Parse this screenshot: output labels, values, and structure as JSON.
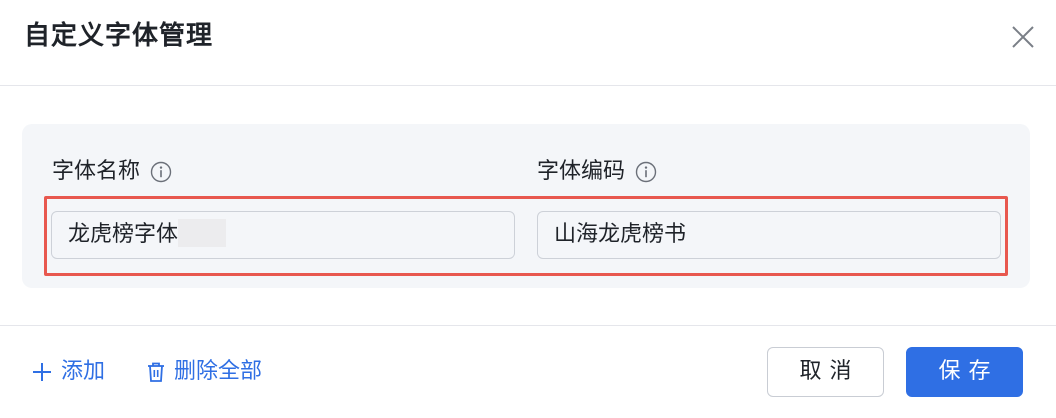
{
  "dialog": {
    "title": "自定义字体管理"
  },
  "form": {
    "font_name_label": "字体名称",
    "font_code_label": "字体编码",
    "font_name_value": "龙虎榜字体",
    "font_code_value": "山海龙虎榜书"
  },
  "footer": {
    "add_label": "添加",
    "delete_all_label": "删除全部",
    "cancel_label": "取消",
    "save_label": "保存"
  },
  "colors": {
    "accent": "#2f6fe4",
    "highlight_border": "#e8584f",
    "panel_bg": "#f4f6f9"
  },
  "icons": {
    "close": "close-icon",
    "info": "info-icon",
    "add": "plus-icon",
    "delete": "trash-icon"
  }
}
